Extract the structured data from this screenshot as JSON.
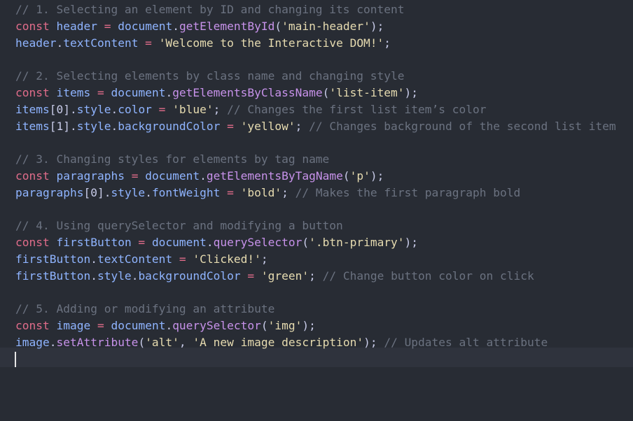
{
  "editor": {
    "cursor_line": 22,
    "lines": [
      [
        {
          "t": "// 1. Selecting an element by ID and changing its content",
          "c": "comment"
        }
      ],
      [
        {
          "t": "const",
          "c": "keyword"
        },
        {
          "t": " ",
          "c": "punc"
        },
        {
          "t": "header",
          "c": "ident"
        },
        {
          "t": " = ",
          "c": "op"
        },
        {
          "t": "document",
          "c": "ident"
        },
        {
          "t": ".",
          "c": "punc"
        },
        {
          "t": "getElementById",
          "c": "func"
        },
        {
          "t": "(",
          "c": "punc"
        },
        {
          "t": "'main-header'",
          "c": "string"
        },
        {
          "t": ");",
          "c": "punc"
        }
      ],
      [
        {
          "t": "header",
          "c": "ident"
        },
        {
          "t": ".",
          "c": "punc"
        },
        {
          "t": "textContent",
          "c": "ident"
        },
        {
          "t": " = ",
          "c": "op"
        },
        {
          "t": "'Welcome to the Interactive DOM!'",
          "c": "string"
        },
        {
          "t": ";",
          "c": "punc"
        }
      ],
      [],
      [
        {
          "t": "// 2. Selecting elements by class name and changing style",
          "c": "comment"
        }
      ],
      [
        {
          "t": "const",
          "c": "keyword"
        },
        {
          "t": " ",
          "c": "punc"
        },
        {
          "t": "items",
          "c": "ident"
        },
        {
          "t": " = ",
          "c": "op"
        },
        {
          "t": "document",
          "c": "ident"
        },
        {
          "t": ".",
          "c": "punc"
        },
        {
          "t": "getElementsByClassName",
          "c": "func"
        },
        {
          "t": "(",
          "c": "punc"
        },
        {
          "t": "'list-item'",
          "c": "string"
        },
        {
          "t": ");",
          "c": "punc"
        }
      ],
      [
        {
          "t": "items",
          "c": "ident"
        },
        {
          "t": "[0].",
          "c": "punc"
        },
        {
          "t": "style",
          "c": "ident"
        },
        {
          "t": ".",
          "c": "punc"
        },
        {
          "t": "color",
          "c": "ident"
        },
        {
          "t": " = ",
          "c": "op"
        },
        {
          "t": "'blue'",
          "c": "string"
        },
        {
          "t": "; ",
          "c": "punc"
        },
        {
          "t": "// Changes the first list item’s color",
          "c": "comment"
        }
      ],
      [
        {
          "t": "items",
          "c": "ident"
        },
        {
          "t": "[1].",
          "c": "punc"
        },
        {
          "t": "style",
          "c": "ident"
        },
        {
          "t": ".",
          "c": "punc"
        },
        {
          "t": "backgroundColor",
          "c": "ident"
        },
        {
          "t": " = ",
          "c": "op"
        },
        {
          "t": "'yellow'",
          "c": "string"
        },
        {
          "t": "; ",
          "c": "punc"
        },
        {
          "t": "// Changes background of the second list item",
          "c": "comment"
        }
      ],
      [],
      [
        {
          "t": "// 3. Changing styles for elements by tag name",
          "c": "comment"
        }
      ],
      [
        {
          "t": "const",
          "c": "keyword"
        },
        {
          "t": " ",
          "c": "punc"
        },
        {
          "t": "paragraphs",
          "c": "ident"
        },
        {
          "t": " = ",
          "c": "op"
        },
        {
          "t": "document",
          "c": "ident"
        },
        {
          "t": ".",
          "c": "punc"
        },
        {
          "t": "getElementsByTagName",
          "c": "func"
        },
        {
          "t": "(",
          "c": "punc"
        },
        {
          "t": "'p'",
          "c": "string"
        },
        {
          "t": ");",
          "c": "punc"
        }
      ],
      [
        {
          "t": "paragraphs",
          "c": "ident"
        },
        {
          "t": "[0].",
          "c": "punc"
        },
        {
          "t": "style",
          "c": "ident"
        },
        {
          "t": ".",
          "c": "punc"
        },
        {
          "t": "fontWeight",
          "c": "ident"
        },
        {
          "t": " = ",
          "c": "op"
        },
        {
          "t": "'bold'",
          "c": "string"
        },
        {
          "t": "; ",
          "c": "punc"
        },
        {
          "t": "// Makes the first paragraph bold",
          "c": "comment"
        }
      ],
      [],
      [
        {
          "t": "// 4. Using querySelector and modifying a button",
          "c": "comment"
        }
      ],
      [
        {
          "t": "const",
          "c": "keyword"
        },
        {
          "t": " ",
          "c": "punc"
        },
        {
          "t": "firstButton",
          "c": "ident"
        },
        {
          "t": " = ",
          "c": "op"
        },
        {
          "t": "document",
          "c": "ident"
        },
        {
          "t": ".",
          "c": "punc"
        },
        {
          "t": "querySelector",
          "c": "func"
        },
        {
          "t": "(",
          "c": "punc"
        },
        {
          "t": "'.btn-primary'",
          "c": "string"
        },
        {
          "t": ");",
          "c": "punc"
        }
      ],
      [
        {
          "t": "firstButton",
          "c": "ident"
        },
        {
          "t": ".",
          "c": "punc"
        },
        {
          "t": "textContent",
          "c": "ident"
        },
        {
          "t": " = ",
          "c": "op"
        },
        {
          "t": "'Clicked!'",
          "c": "string"
        },
        {
          "t": ";",
          "c": "punc"
        }
      ],
      [
        {
          "t": "firstButton",
          "c": "ident"
        },
        {
          "t": ".",
          "c": "punc"
        },
        {
          "t": "style",
          "c": "ident"
        },
        {
          "t": ".",
          "c": "punc"
        },
        {
          "t": "backgroundColor",
          "c": "ident"
        },
        {
          "t": " = ",
          "c": "op"
        },
        {
          "t": "'green'",
          "c": "string"
        },
        {
          "t": "; ",
          "c": "punc"
        },
        {
          "t": "// Change button color on click",
          "c": "comment"
        }
      ],
      [],
      [
        {
          "t": "// 5. Adding or modifying an attribute",
          "c": "comment"
        }
      ],
      [
        {
          "t": "const",
          "c": "keyword"
        },
        {
          "t": " ",
          "c": "punc"
        },
        {
          "t": "image",
          "c": "ident"
        },
        {
          "t": " = ",
          "c": "op"
        },
        {
          "t": "document",
          "c": "ident"
        },
        {
          "t": ".",
          "c": "punc"
        },
        {
          "t": "querySelector",
          "c": "func"
        },
        {
          "t": "(",
          "c": "punc"
        },
        {
          "t": "'img'",
          "c": "string"
        },
        {
          "t": ");",
          "c": "punc"
        }
      ],
      [
        {
          "t": "image",
          "c": "ident"
        },
        {
          "t": ".",
          "c": "punc"
        },
        {
          "t": "setAttribute",
          "c": "func"
        },
        {
          "t": "(",
          "c": "punc"
        },
        {
          "t": "'alt'",
          "c": "string"
        },
        {
          "t": ", ",
          "c": "punc"
        },
        {
          "t": "'A new image description'",
          "c": "string"
        },
        {
          "t": "); ",
          "c": "punc"
        },
        {
          "t": "// Updates alt attribute",
          "c": "comment"
        }
      ],
      []
    ]
  },
  "colors": {
    "background": "#282c34",
    "current_line": "#2f333d",
    "comment": "#6b7280",
    "keyword": "#e06c8a",
    "identifier": "#8fb4ff",
    "function": "#c792ea",
    "string": "#e6dbb0",
    "cursor": "#e6e6e6"
  }
}
